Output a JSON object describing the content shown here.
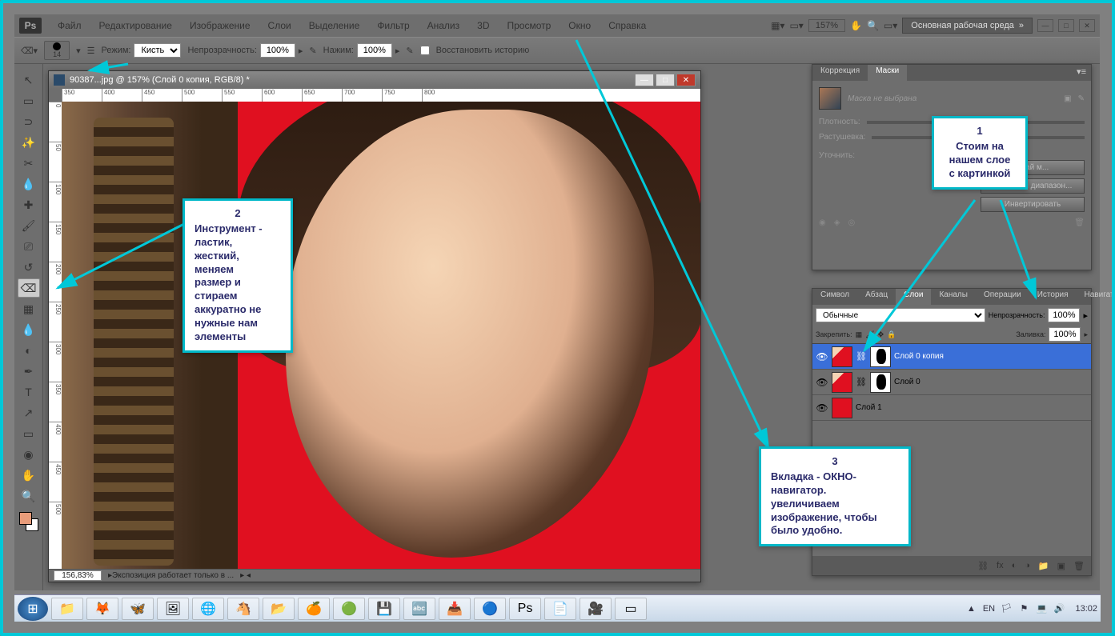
{
  "menu": {
    "items": [
      "Файл",
      "Редактирование",
      "Изображение",
      "Слои",
      "Выделение",
      "Фильтр",
      "Анализ",
      "3D",
      "Просмотр",
      "Окно",
      "Справка"
    ],
    "zoom": "157%",
    "workspace": "Основная рабочая среда"
  },
  "options": {
    "brush_size": "14",
    "mode_label": "Режим:",
    "mode_value": "Кисть",
    "opacity_label": "Непрозрачность:",
    "opacity_value": "100%",
    "flow_label": "Нажим:",
    "flow_value": "100%",
    "restore_label": "Восстановить историю"
  },
  "document": {
    "title": "90387...jpg @ 157% (Слой 0 копия, RGB/8) *",
    "ruler_h": [
      "350",
      "400",
      "450",
      "500",
      "550",
      "600",
      "650",
      "700",
      "750",
      "800"
    ],
    "ruler_v": [
      "0",
      "50",
      "100",
      "150",
      "200",
      "250",
      "300",
      "350",
      "400",
      "450",
      "500"
    ],
    "status_zoom": "156,83%",
    "status_text": "Экспозиция работает только в ..."
  },
  "masks": {
    "tab1": "Коррекция",
    "tab2": "Маски",
    "no_mask": "Маска не выбрана",
    "density": "Плотность:",
    "feather": "Растушевка:",
    "refine": "Уточнить:",
    "btn_edge": "Край м...",
    "btn_color": "Цветовой диапазон...",
    "btn_invert": "Инвертировать"
  },
  "layers": {
    "tabs": [
      "Символ",
      "Абзац",
      "Слои",
      "Каналы",
      "Операции",
      "История",
      "Навигатор"
    ],
    "blend": "Обычные",
    "opacity_label": "Непрозрачность:",
    "opacity_value": "100%",
    "lock_label": "Закрепить:",
    "fill_label": "Заливка:",
    "fill_value": "100%",
    "rows": [
      {
        "name": "Слой 0 копия",
        "selected": true,
        "thumb": "img",
        "mask": true
      },
      {
        "name": "Слой 0",
        "selected": false,
        "thumb": "img",
        "mask": true
      },
      {
        "name": "Слой 1",
        "selected": false,
        "thumb": "red",
        "mask": false
      }
    ]
  },
  "callouts": {
    "c1": {
      "num": "1",
      "text": "Стоим на\nнашем слое\nс картинкой"
    },
    "c2": {
      "num": "2",
      "text": "Инструмент -\nластик,\nжесткий,\nменяем\nразмер и\nстираем\nаккуратно не\nнужные нам\nэлементы"
    },
    "c3": {
      "num": "3",
      "text": "Вкладка - ОКНО-\nнавигатор.\nувеличиваем\nизображение, чтобы\nбыло удобно."
    }
  },
  "taskbar": {
    "lang": "EN",
    "time": "13:02"
  }
}
